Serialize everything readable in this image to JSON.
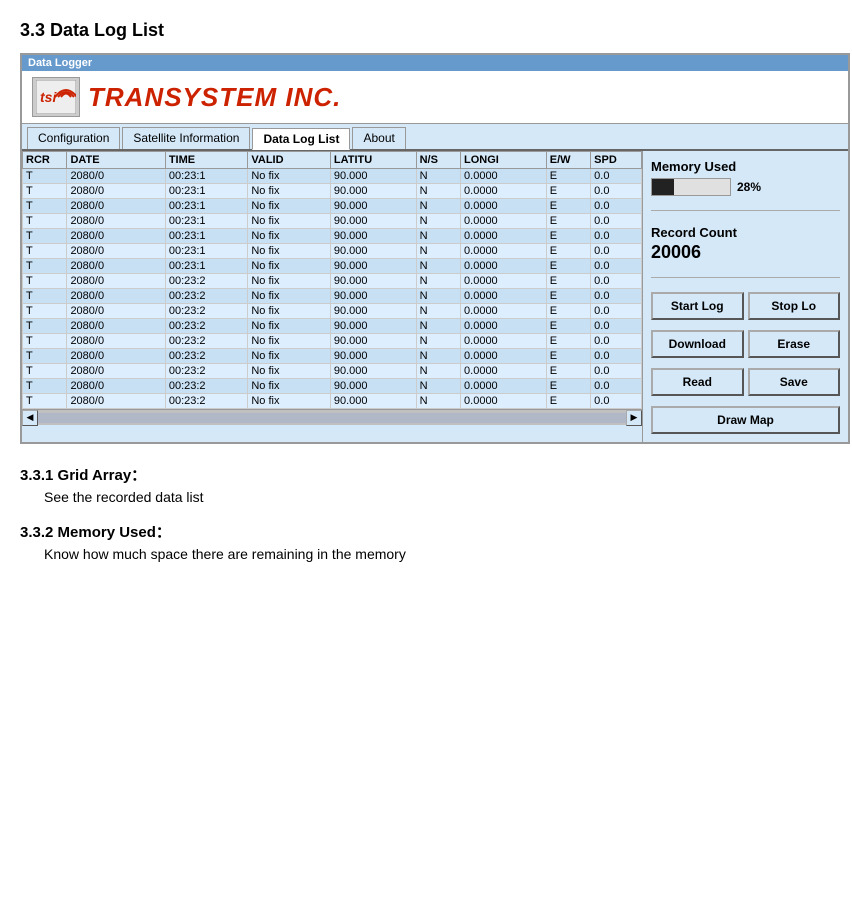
{
  "page": {
    "title": "3.3 Data Log List",
    "subsection1_title": "3.3.1 Grid Array：",
    "subsection1_body": "See the recorded data list",
    "subsection2_title": "3.3.2 Memory Used：",
    "subsection2_body": "Know how much space there are remaining in the memory"
  },
  "window": {
    "title_bar": "Data Logger"
  },
  "logo": {
    "icon_text": "tsi",
    "text": "TRANSYSTEM INC."
  },
  "tabs": [
    {
      "label": "Configuration",
      "active": false
    },
    {
      "label": "Satellite Information",
      "active": false
    },
    {
      "label": "Data Log List",
      "active": true
    },
    {
      "label": "About",
      "active": false
    }
  ],
  "table": {
    "columns": [
      "RCR",
      "DATE",
      "TIME",
      "VALID",
      "LATITU",
      "N/S",
      "LONGI",
      "E/W",
      "SPD"
    ],
    "rows": [
      [
        "T",
        "2080/0",
        "00:23:1",
        "No fix",
        "90.000",
        "N",
        "0.0000",
        "E",
        "0.0"
      ],
      [
        "T",
        "2080/0",
        "00:23:1",
        "No fix",
        "90.000",
        "N",
        "0.0000",
        "E",
        "0.0"
      ],
      [
        "T",
        "2080/0",
        "00:23:1",
        "No fix",
        "90.000",
        "N",
        "0.0000",
        "E",
        "0.0"
      ],
      [
        "T",
        "2080/0",
        "00:23:1",
        "No fix",
        "90.000",
        "N",
        "0.0000",
        "E",
        "0.0"
      ],
      [
        "T",
        "2080/0",
        "00:23:1",
        "No fix",
        "90.000",
        "N",
        "0.0000",
        "E",
        "0.0"
      ],
      [
        "T",
        "2080/0",
        "00:23:1",
        "No fix",
        "90.000",
        "N",
        "0.0000",
        "E",
        "0.0"
      ],
      [
        "T",
        "2080/0",
        "00:23:1",
        "No fix",
        "90.000",
        "N",
        "0.0000",
        "E",
        "0.0"
      ],
      [
        "T",
        "2080/0",
        "00:23:2",
        "No fix",
        "90.000",
        "N",
        "0.0000",
        "E",
        "0.0"
      ],
      [
        "T",
        "2080/0",
        "00:23:2",
        "No fix",
        "90.000",
        "N",
        "0.0000",
        "E",
        "0.0"
      ],
      [
        "T",
        "2080/0",
        "00:23:2",
        "No fix",
        "90.000",
        "N",
        "0.0000",
        "E",
        "0.0"
      ],
      [
        "T",
        "2080/0",
        "00:23:2",
        "No fix",
        "90.000",
        "N",
        "0.0000",
        "E",
        "0.0"
      ],
      [
        "T",
        "2080/0",
        "00:23:2",
        "No fix",
        "90.000",
        "N",
        "0.0000",
        "E",
        "0.0"
      ],
      [
        "T",
        "2080/0",
        "00:23:2",
        "No fix",
        "90.000",
        "N",
        "0.0000",
        "E",
        "0.0"
      ],
      [
        "T",
        "2080/0",
        "00:23:2",
        "No fix",
        "90.000",
        "N",
        "0.0000",
        "E",
        "0.0"
      ],
      [
        "T",
        "2080/0",
        "00:23:2",
        "No fix",
        "90.000",
        "N",
        "0.0000",
        "E",
        "0.0"
      ],
      [
        "T",
        "2080/0",
        "00:23:2",
        "No fix",
        "90.000",
        "N",
        "0.0000",
        "E",
        "0.0"
      ]
    ]
  },
  "right_panel": {
    "memory_used_label": "Memory Used",
    "memory_percent": "28%",
    "memory_bar_fill_pct": 28,
    "record_count_label": "Record Count",
    "record_count_value": "20006",
    "buttons": {
      "start_log": "Start Log",
      "stop_log": "Stop Lo",
      "download": "Download",
      "erase": "Erase",
      "read": "Read",
      "save": "Save",
      "draw_map": "Draw Map"
    }
  }
}
